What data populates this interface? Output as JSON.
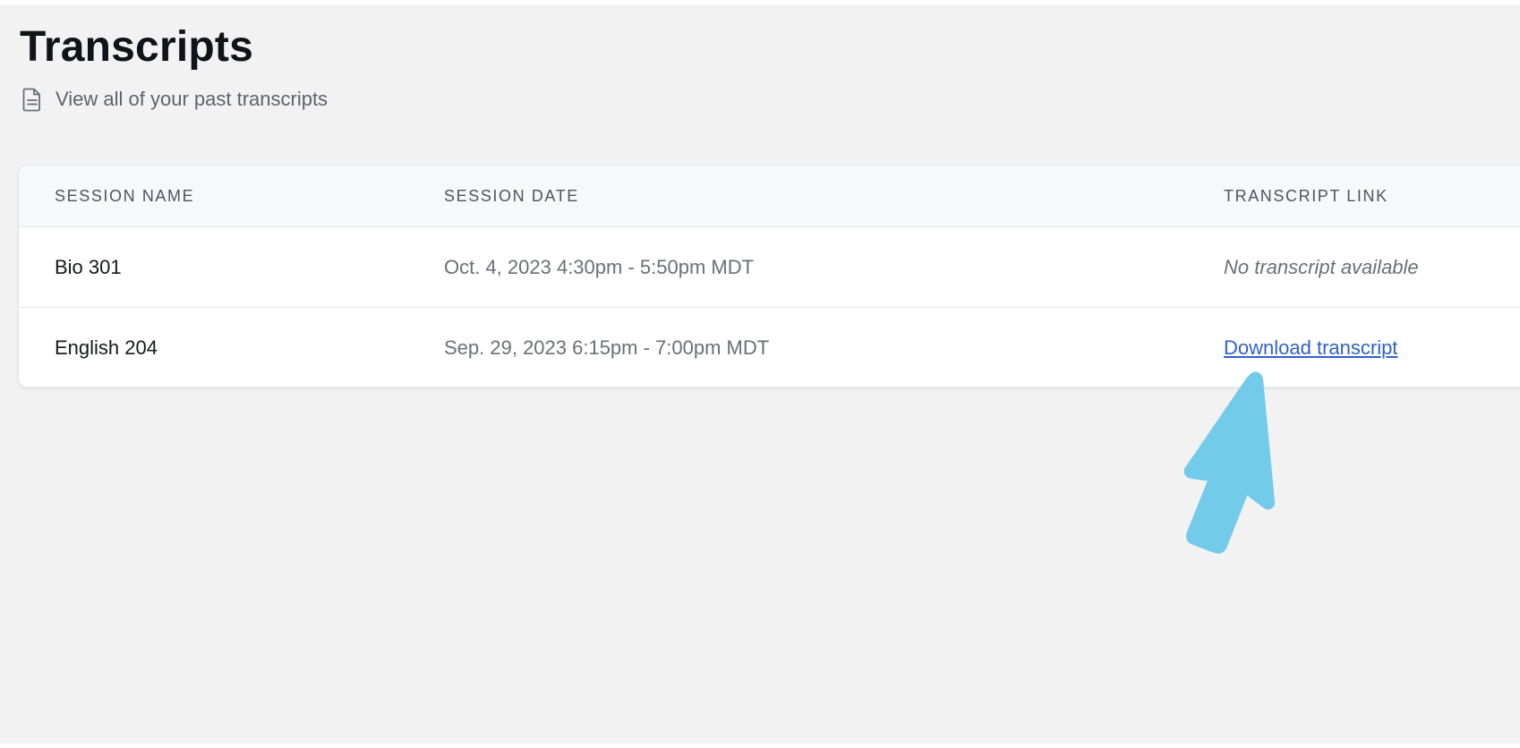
{
  "page": {
    "title": "Transcripts",
    "subtitle": "View all of your past transcripts",
    "subtitle_icon": "document-icon"
  },
  "table": {
    "headers": {
      "session_name": "SESSION NAME",
      "session_date": "SESSION DATE",
      "transcript_link": "TRANSCRIPT LINK"
    },
    "rows": [
      {
        "session_name": "Bio 301",
        "session_date": "Oct. 4, 2023 4:30pm - 5:50pm MDT",
        "transcript": "No transcript available"
      },
      {
        "session_name": "English 204",
        "session_date": "Sep. 29, 2023 6:15pm - 7:00pm MDT",
        "transcript": "Download transcript"
      }
    ]
  },
  "annotation": {
    "icon": "pointer-arrow-icon",
    "color": "#73cbea"
  },
  "colors": {
    "background": "#f2f2f3",
    "link": "#2f62c9",
    "title": "#111318"
  }
}
